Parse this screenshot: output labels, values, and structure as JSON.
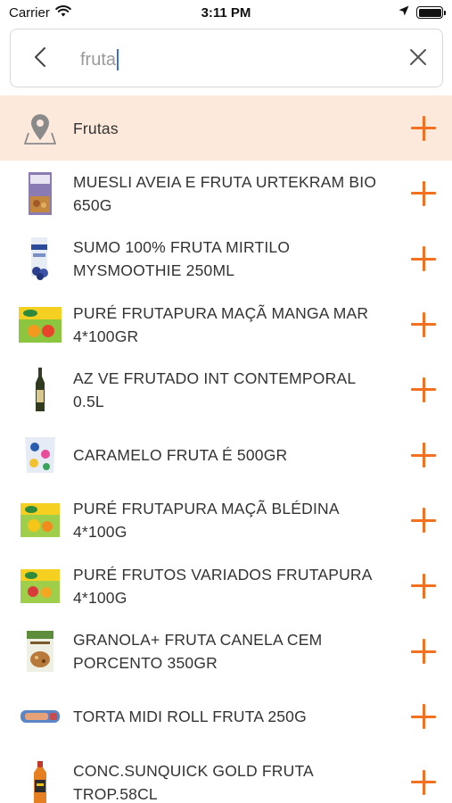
{
  "status_bar": {
    "carrier": "Carrier",
    "time": "3:11 PM"
  },
  "search": {
    "query": "fruta",
    "back_icon": "chevron-left-icon",
    "clear_icon": "close-icon"
  },
  "colors": {
    "accent": "#f37021",
    "category_bg": "#fde9dc"
  },
  "category": {
    "label": "Frutas",
    "icon": "map-pin-icon"
  },
  "products": [
    {
      "label": "MUESLI AVEIA E FRUTA URTEKRAM BIO 650G"
    },
    {
      "label": "SUMO 100% FRUTA MIRTILO MYSMOOTHIE 250ML"
    },
    {
      "label": "PURÉ FRUTAPURA MAÇÃ MANGA MAR 4*100GR"
    },
    {
      "label": "AZ VE FRUTADO INT CONTEMPORAL 0.5L"
    },
    {
      "label": "CARAMELO FRUTA É 500GR"
    },
    {
      "label": "PURÉ FRUTAPURA MAÇÃ BLÉDINA 4*100G"
    },
    {
      "label": "PURÉ FRUTOS VARIADOS FRUTAPURA 4*100G"
    },
    {
      "label": "GRANOLA+ FRUTA CANELA CEM PORCENTO 350GR"
    },
    {
      "label": "TORTA MIDI ROLL FRUTA 250G"
    },
    {
      "label": "CONC.SUNQUICK GOLD FRUTA TROP.58CL"
    }
  ]
}
